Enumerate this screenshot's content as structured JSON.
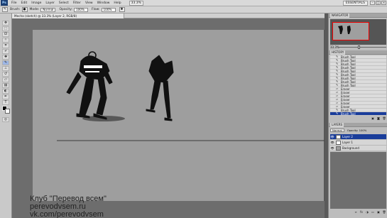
{
  "app": {
    "logo": "Ps"
  },
  "menu": {
    "items": [
      "File",
      "Edit",
      "Image",
      "Layer",
      "Select",
      "Filter",
      "View",
      "Window",
      "Help"
    ],
    "zoom": "33.3%",
    "workspace": "ESSENTIALS"
  },
  "options": {
    "brush_label": "Brush:",
    "mode_label": "Mode:",
    "mode_value": "Normal",
    "opacity_label": "Opacity:",
    "opacity_value": "100%",
    "flow_label": "Flow:",
    "flow_value": "100%"
  },
  "document": {
    "tab_title": "Mecha (sketch) @ 33.3% (Layer 2, RGB/8)"
  },
  "watermark": {
    "lines": [
      "Клуб \"Перевод всем\"",
      "perevodvsem.ru",
      "vk.com/perevodvsem"
    ]
  },
  "navigator": {
    "tab": "NAVIGATOR",
    "zoom": "33.3%"
  },
  "history": {
    "tab": "HISTORY",
    "items": [
      "Brush Tool",
      "Brush Tool",
      "Brush Tool",
      "Brush Tool",
      "Brush Tool",
      "Brush Tool",
      "Brush Tool",
      "Brush Tool",
      "Brush Tool",
      "Eraser",
      "Eraser",
      "Eraser",
      "Eraser",
      "Eraser",
      "Eraser",
      "Brush Tool",
      "Brush Tool"
    ],
    "selected_index": 16
  },
  "layers": {
    "tab": "LAYERS",
    "blend_mode": "Normal",
    "opacity_label": "Opacity: 100%",
    "items": [
      {
        "name": "Layer 2",
        "selected": true
      },
      {
        "name": "Layer 1",
        "selected": false
      },
      {
        "name": "Background",
        "selected": false
      }
    ]
  },
  "colors": {
    "foreground": "#000000",
    "background": "#ffffff",
    "selection": "#1a3d9a"
  }
}
